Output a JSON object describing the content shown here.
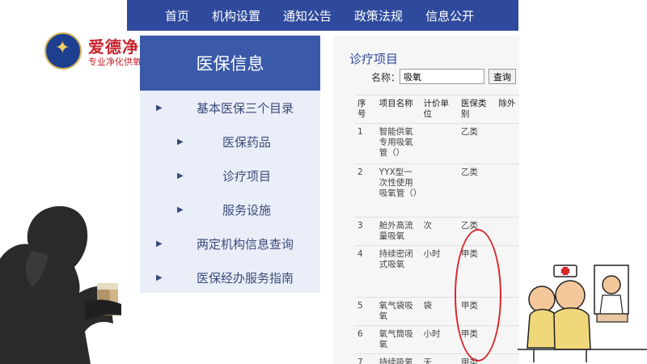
{
  "nav": {
    "items": [
      "首页",
      "机构设置",
      "通知公告",
      "政策法规",
      "信息公开"
    ]
  },
  "logo": {
    "brand": "爱德净化",
    "tagline": "专业净化供氧"
  },
  "sidebar": {
    "title": "医保信息",
    "items": [
      {
        "label": "基本医保三个目录",
        "level": 1
      },
      {
        "label": "医保药品",
        "level": 2
      },
      {
        "label": "诊疗项目",
        "level": 2
      },
      {
        "label": "服务设施",
        "level": 2
      },
      {
        "label": "两定机构信息查询",
        "level": 1
      },
      {
        "label": "医保经办服务指南",
        "level": 1
      }
    ]
  },
  "panel": {
    "title": "诊疗项目",
    "search": {
      "label": "名称：",
      "value": "吸氧",
      "button": "查询"
    },
    "table": {
      "headers": [
        "序号",
        "项目名称",
        "计价单位",
        "医保类别",
        "除外"
      ],
      "rows": [
        [
          "1",
          "智能供氧专用吸氧管（）",
          "",
          "乙类",
          ""
        ],
        [
          "2",
          "YYX型一次性使用吸氧管（）",
          "",
          "乙类",
          ""
        ],
        [
          "3",
          "舱外高流量吸氧",
          "次",
          "乙类",
          ""
        ],
        [
          "4",
          "持续密闭式吸氧",
          "小时",
          "甲类",
          ""
        ],
        [
          "5",
          "氧气袋吸氧",
          "袋",
          "甲类",
          ""
        ],
        [
          "6",
          "氧气筒吸氧",
          "小时",
          "甲类",
          ""
        ],
        [
          "7",
          "持续吸氧",
          "天",
          "甲类",
          ""
        ]
      ]
    }
  },
  "colors": {
    "nav_bg": "#2f4a9c",
    "sidebar_head": "#3a5aa9",
    "sidebar_bg": "#e9eef8",
    "highlight_oval": "#d8262d",
    "brand_red": "#c8232c"
  }
}
